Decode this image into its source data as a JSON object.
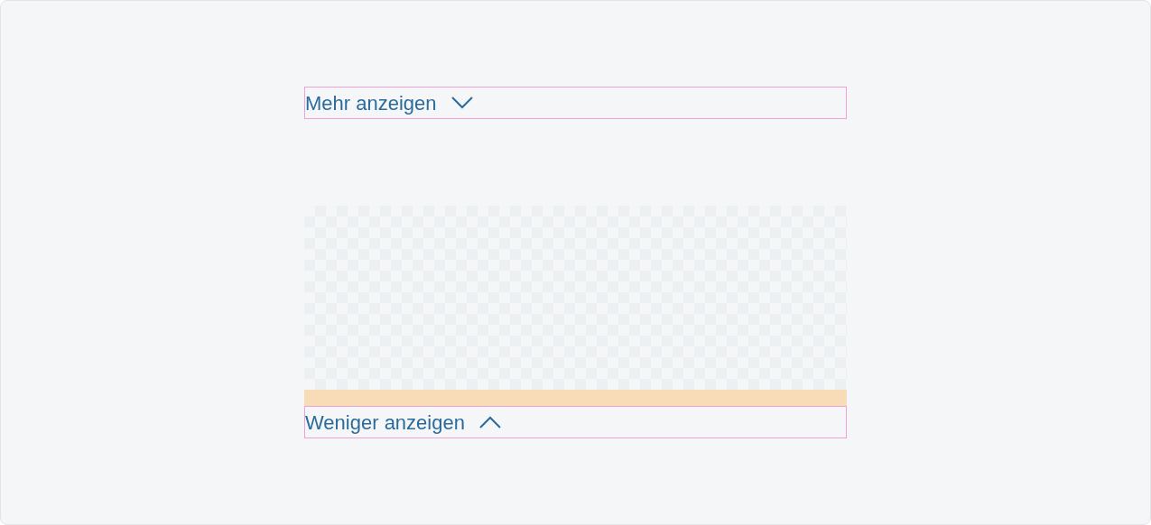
{
  "expanders": [
    {
      "label": "Mehr anzeigen",
      "expanded": false
    },
    {
      "label": "Weniger anzeigen",
      "expanded": true
    }
  ]
}
